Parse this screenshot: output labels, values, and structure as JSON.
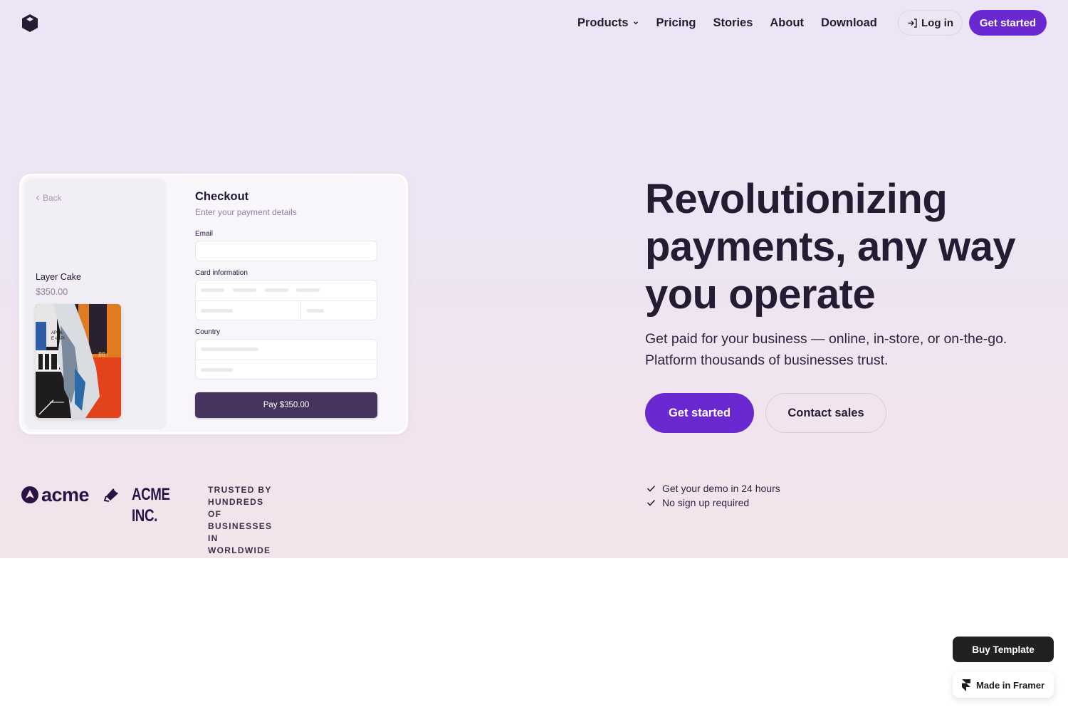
{
  "nav": {
    "logo_icon": "cube-icon",
    "links": [
      {
        "label": "Products",
        "has_dropdown": true
      },
      {
        "label": "Pricing"
      },
      {
        "label": "Stories"
      },
      {
        "label": "About"
      },
      {
        "label": "Download"
      }
    ],
    "login_label": "Log in",
    "login_icon": "sign-in-icon",
    "get_started_label": "Get started"
  },
  "checkout": {
    "back_label": "Back",
    "product_name": "Layer Cake",
    "product_price": "$350.00",
    "title": "Checkout",
    "subtitle": "Enter your payment details",
    "email_label": "Email",
    "email_value": "",
    "card_label": "Card information",
    "country_label": "Country",
    "pay_label": "Pay $350.00"
  },
  "hero": {
    "headline": "Revolutionizing payments, any way you operate",
    "subtext": "Get paid for your business — online, in-store, or  on-the-go. Platform thousands of businesses trust.",
    "primary_cta": "Get started",
    "secondary_cta": "Contact sales",
    "checks": [
      "Get your demo in 24 hours",
      "No sign up required"
    ]
  },
  "logos": {
    "brands": [
      "acme",
      "ACME INC."
    ],
    "trusted_line1": "TRUSTED BY HUNDREDS",
    "trusted_line2": "OF BUSINESSES IN WORLDWIDE"
  },
  "badges": {
    "buy_template": "Buy Template",
    "made_in_framer": "Made in Framer"
  },
  "colors": {
    "accent": "#6a28d0",
    "text_dark": "#231c33",
    "pay_button": "#46345e",
    "brand_logo": "#2a1246"
  }
}
